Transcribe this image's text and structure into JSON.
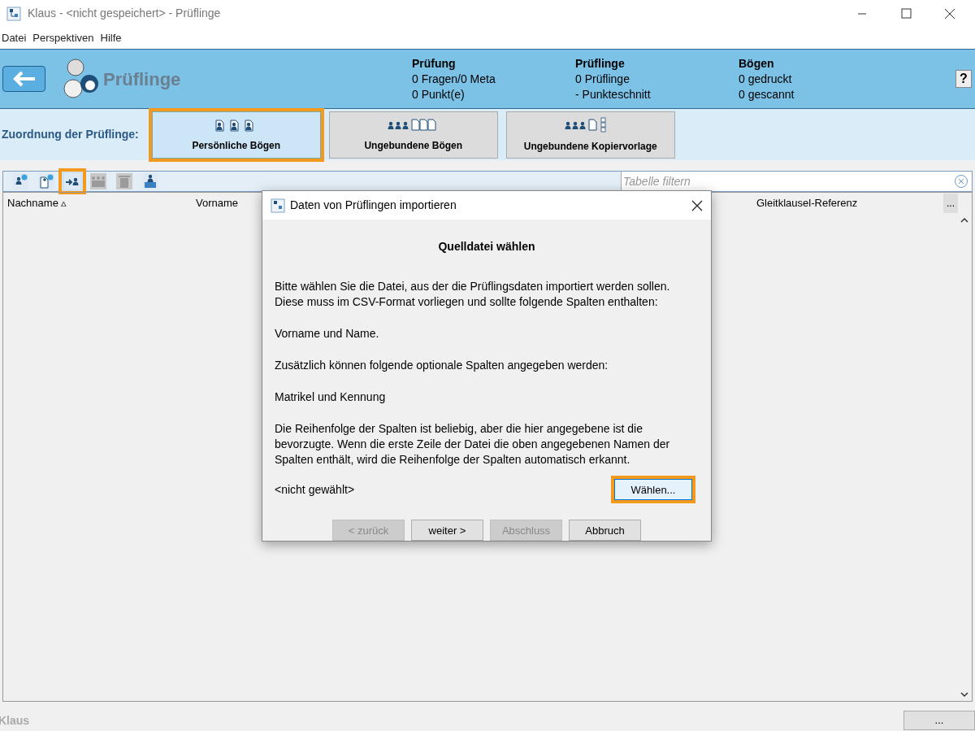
{
  "window": {
    "title": "Klaus - <nicht gespeichert> - Prüflinge"
  },
  "menu": [
    "Datei",
    "Perspektiven",
    "Hilfe"
  ],
  "header": {
    "title": "Prüflinge",
    "help": "?",
    "stats": [
      {
        "heading": "Prüfung",
        "lines": [
          "0 Fragen/0 Meta",
          "0 Punkt(e)"
        ]
      },
      {
        "heading": "Prüflinge",
        "lines": [
          "0 Prüflinge",
          "- Punkteschnitt"
        ]
      },
      {
        "heading": "Bögen",
        "lines": [
          "0 gedruckt",
          "0 gescannt"
        ]
      }
    ]
  },
  "assignment": {
    "label": "Zuordnung der Prüflinge:",
    "tabs": [
      {
        "label": "Persönliche Bögen",
        "kind": "personal",
        "selected": true,
        "highlighted": true
      },
      {
        "label": "Ungebundene Bögen",
        "kind": "unbound",
        "selected": false,
        "highlighted": false
      },
      {
        "label": "Ungebundene Kopiervorlage",
        "kind": "template",
        "selected": false,
        "highlighted": false
      }
    ]
  },
  "toolbar": [
    {
      "kind": "add-person",
      "disabled": false,
      "highlighted": false
    },
    {
      "kind": "add-sheet",
      "disabled": false,
      "highlighted": false
    },
    {
      "kind": "import",
      "disabled": false,
      "highlighted": true
    },
    {
      "kind": "group",
      "disabled": true,
      "highlighted": false
    },
    {
      "kind": "delete",
      "disabled": true,
      "highlighted": false
    },
    {
      "kind": "export",
      "disabled": false,
      "highlighted": false
    }
  ],
  "filter": {
    "placeholder": "Tabelle filtern"
  },
  "table": {
    "columns": [
      "Nachname ▵",
      "Vorname",
      "Gleitklausel-Referenz"
    ],
    "more": "..."
  },
  "status_bar": {
    "text": "Klaus",
    "button": "..."
  },
  "dialog": {
    "title": "Daten von Prüflingen importieren",
    "heading": "Quelldatei wählen",
    "paragraphs": [
      "Bitte wählen Sie die Datei, aus der die Prüflingsdaten importiert werden sollen. Diese muss im CSV-Format vorliegen und sollte folgende Spalten enthalten:",
      "Vorname und Name.",
      "Zusätzlich können folgende optionale Spalten angegeben werden:",
      "Matrikel und Kennung",
      "Die Reihenfolge der Spalten ist beliebig, aber die hier angegebene ist die bevorzugte. Wenn die erste Zeile der Datei die oben angegebenen Namen der Spalten enthält, wird die Reihenfolge der Spalten automatisch erkannt."
    ],
    "file": "<nicht gewählt>",
    "choose": {
      "label": "Wählen...",
      "highlighted": true
    },
    "buttons": [
      {
        "label": "< zurück",
        "disabled": true
      },
      {
        "label": "weiter >",
        "disabled": false
      },
      {
        "label": "Abschluss",
        "disabled": true
      },
      {
        "label": "Abbruch",
        "disabled": false
      }
    ]
  }
}
